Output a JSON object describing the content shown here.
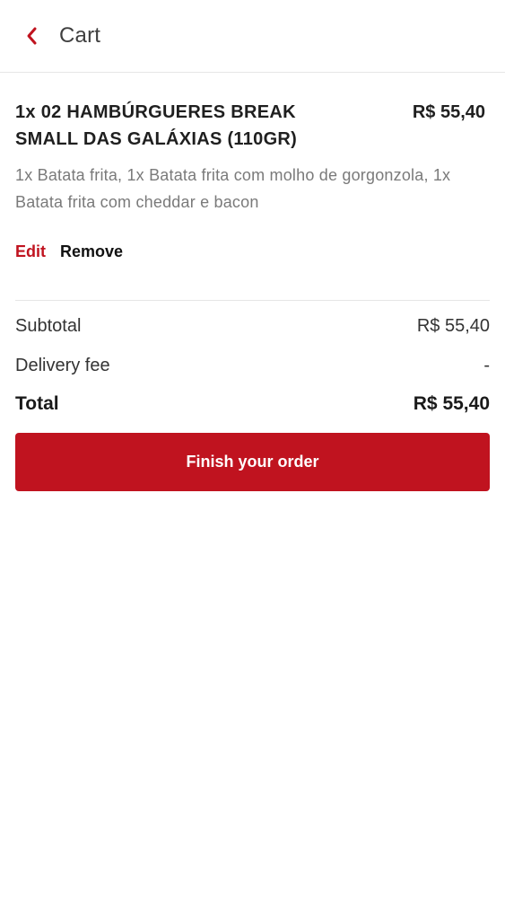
{
  "header": {
    "back_icon": "chevron-left-icon",
    "title": "Cart"
  },
  "colors": {
    "accent": "#c0131f",
    "muted_text": "#7a7a7a",
    "divider": "#e6e6e6"
  },
  "cart_item": {
    "name": "1x 02 HAMBÚRGUERES BREAK SMALL DAS GALÁXIAS (110GR)",
    "price": "R$ 55,40",
    "options": "1x Batata frita, 1x Batata frita com molho de gorgonzola, 1x Batata frita com cheddar e bacon",
    "edit_label": "Edit",
    "remove_label": "Remove"
  },
  "summary": {
    "subtotal_label": "Subtotal",
    "subtotal_value": "R$ 55,40",
    "delivery_label": "Delivery fee",
    "delivery_value": "-",
    "total_label": "Total",
    "total_value": "R$ 55,40"
  },
  "actions": {
    "finish_label": "Finish your order"
  }
}
